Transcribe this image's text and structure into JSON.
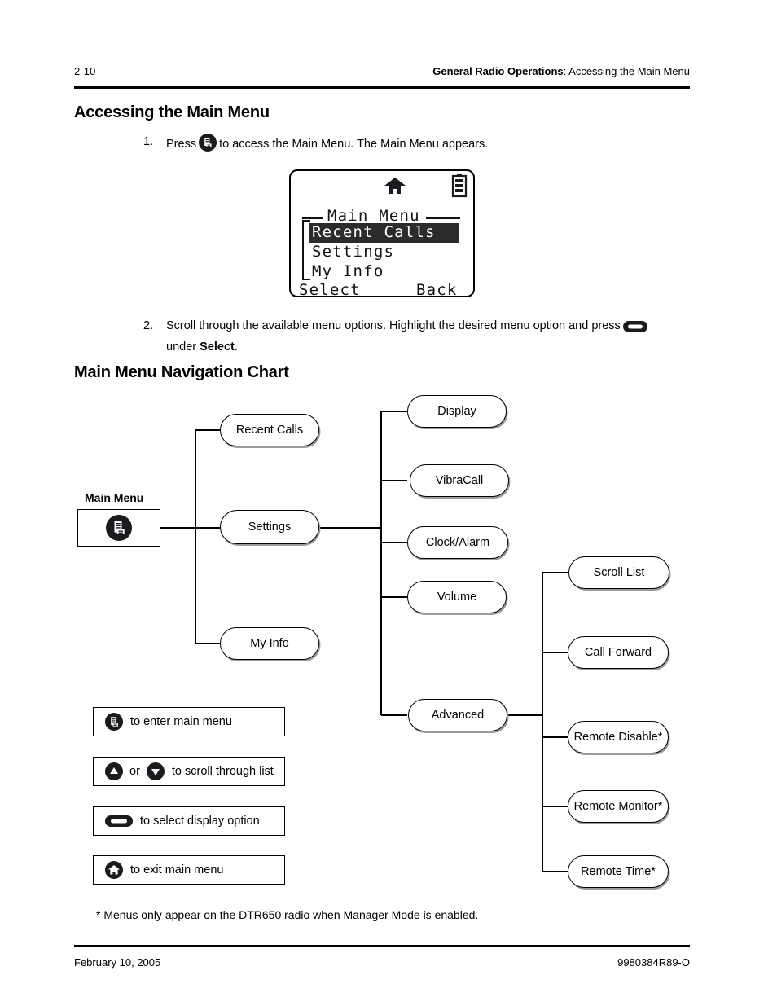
{
  "header": {
    "page_number": "2-10",
    "section_bold": "General Radio Operations",
    "section_rest": ": Accessing the Main Menu"
  },
  "headings": {
    "accessing": "Accessing the Main Menu",
    "nav_chart": "Main Menu Navigation Chart"
  },
  "steps": [
    {
      "number": "1.",
      "text_before": "Press",
      "icon": "menu-key-icon",
      "text_after": "to access the Main Menu. The Main Menu appears."
    },
    {
      "number": "2.",
      "text_before": "Scroll through the available menu options. Highlight the desired menu option and press",
      "icon": "select-key-icon",
      "text_after_line2_prefix": "under ",
      "text_after_line2_bold": "Select",
      "text_after_line2_suffix": "."
    }
  ],
  "lcd": {
    "status_icons": [
      "home-icon",
      "battery-icon"
    ],
    "title": "Main Menu",
    "items": [
      {
        "label": "Recent Calls",
        "selected": true
      },
      {
        "label": "Settings",
        "selected": false
      },
      {
        "label": "My Info",
        "selected": false
      }
    ],
    "softkey_left": "Select",
    "softkey_right": "Back"
  },
  "nav_chart": {
    "root": {
      "label": "Main Menu",
      "icon": "menu-key-icon"
    },
    "level1": [
      {
        "label": "Recent Calls"
      },
      {
        "label": "Settings"
      },
      {
        "label": "My Info"
      }
    ],
    "level2": [
      {
        "label": "Display"
      },
      {
        "label": "VibraCall"
      },
      {
        "label": "Clock/Alarm"
      },
      {
        "label": "Volume"
      },
      {
        "label": "Advanced"
      }
    ],
    "level3": [
      {
        "label": "Scroll List"
      },
      {
        "label": "Call Forward"
      },
      {
        "label": "Remote Disable*"
      },
      {
        "label": "Remote Monitor*"
      },
      {
        "label": "Remote Time*"
      }
    ]
  },
  "legend": [
    {
      "icons": [
        "menu-key-icon"
      ],
      "text": "to enter main menu"
    },
    {
      "icons": [
        "up-arrow-key-icon",
        "down-arrow-key-icon"
      ],
      "separator": "or",
      "text": "to scroll through list"
    },
    {
      "icons": [
        "select-key-icon"
      ],
      "text": "to select display option"
    },
    {
      "icons": [
        "home-key-icon"
      ],
      "text": "to exit main menu"
    }
  ],
  "footnote": "* Menus only appear on the DTR650 radio when Manager Mode is enabled.",
  "footer": {
    "left": "February 10, 2005",
    "right": "9980384R89-O"
  },
  "colors": {
    "key_fill": "#1b1b1f",
    "node_shadow": "#9a9a9a",
    "lcd_highlight": "#2b2b2b"
  }
}
